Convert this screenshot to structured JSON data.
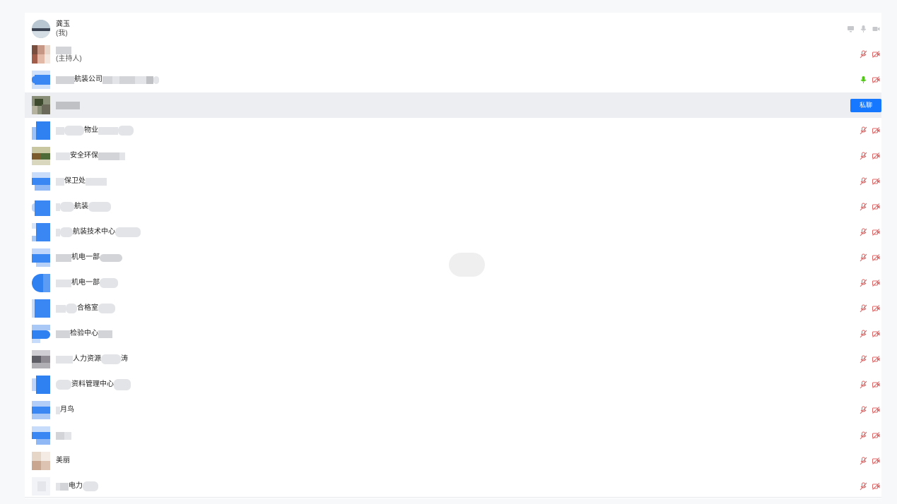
{
  "participants": [
    {
      "name": "龚玉",
      "role": "(我)",
      "status": "self"
    },
    {
      "name": "",
      "role": "(主持人)",
      "status": "muted"
    },
    {
      "name": "航装公司",
      "role": "",
      "status": "speaking"
    },
    {
      "name": "",
      "role": "",
      "status": "hover",
      "action": "私聊"
    },
    {
      "name": "物业",
      "role": "",
      "status": "muted"
    },
    {
      "name": "安全环保",
      "role": "",
      "status": "muted"
    },
    {
      "name": "保卫处",
      "role": "",
      "status": "muted"
    },
    {
      "name": "航装",
      "role": "",
      "status": "muted"
    },
    {
      "name": "航装技术中心",
      "role": "",
      "status": "muted"
    },
    {
      "name": "机电一部",
      "role": "",
      "status": "muted"
    },
    {
      "name": "机电一部",
      "role": "",
      "status": "muted"
    },
    {
      "name": "合格室",
      "role": "",
      "status": "muted"
    },
    {
      "name": "检验中心",
      "role": "",
      "status": "muted"
    },
    {
      "name": "人力资源",
      "role": "",
      "status": "muted"
    },
    {
      "name": "资料管理中心",
      "role": "",
      "status": "muted"
    },
    {
      "name": "月鸟",
      "role": "",
      "status": "muted"
    },
    {
      "name": "",
      "role": "",
      "status": "muted"
    },
    {
      "name": "美丽",
      "role": "",
      "status": "muted"
    },
    {
      "name": "电力",
      "role": "",
      "status": "muted"
    }
  ],
  "colors": {
    "accent": "#1677ff",
    "muted_icon": "#e06666",
    "speaking_icon": "#52c41a",
    "self_icon": "#c6c8cc",
    "highlight_row": "#eceef2"
  },
  "icons": {
    "screen": "screen-share-icon",
    "mic": "microphone-icon",
    "mic_muted": "mic-muted-icon",
    "camera": "camera-icon",
    "camera_off": "camera-off-icon"
  }
}
